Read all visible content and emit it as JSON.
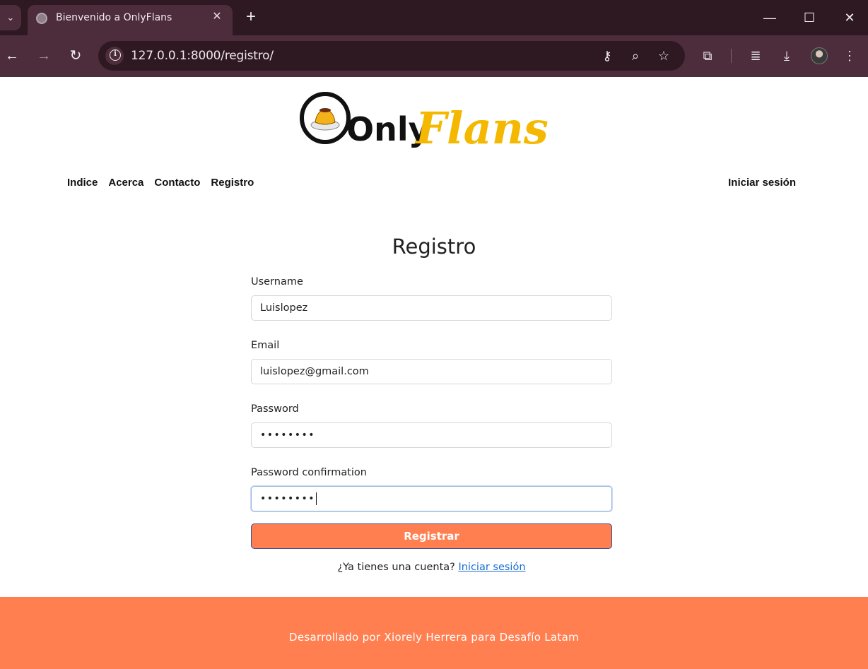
{
  "browser": {
    "tab_title": "Bienvenido a OnlyFlans",
    "url": "127.0.0.1:8000/registro/",
    "new_tab_symbol": "+",
    "close_tab_symbol": "✕"
  },
  "site": {
    "logo_text_left": "Only",
    "logo_text_right": "Flans",
    "nav": [
      "Indice",
      "Acerca",
      "Contacto",
      "Registro"
    ],
    "nav_right": "Iniciar sesión"
  },
  "form": {
    "title": "Registro",
    "username_label": "Username",
    "username_value": "Luislopez",
    "email_label": "Email",
    "email_value": "luislopez@gmail.com",
    "password_label": "Password",
    "password_value": "••••••••",
    "password_confirm_label": "Password confirmation",
    "password_confirm_value": "••••••••",
    "submit_label": "Registrar",
    "login_prompt": "¿Ya tienes una cuenta?",
    "login_link": "Iniciar sesión"
  },
  "footer": {
    "text": "Desarrollado por Xiorely Herrera para Desafío Latam"
  },
  "colors": {
    "accent": "#ff7f50",
    "logo_yellow": "#f5b800",
    "chrome": "#4d2d3b",
    "link": "#1a6fd0"
  }
}
